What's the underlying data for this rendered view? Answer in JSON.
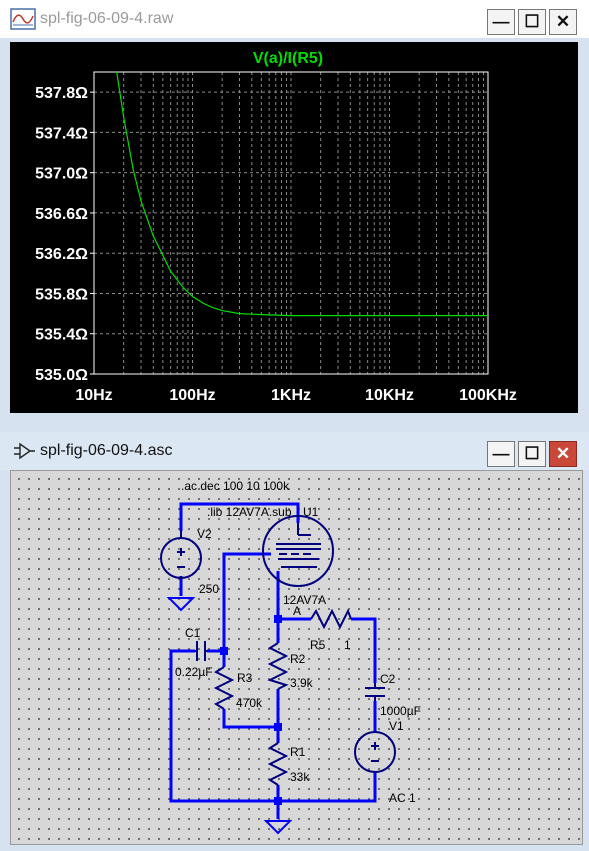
{
  "plot_window": {
    "title": "spl-fig-06-09-4.raw",
    "icon": "waveform-icon",
    "buttons": {
      "minimize": "—",
      "maximize": "☐",
      "close": "✕"
    }
  },
  "schematic_window": {
    "title": "spl-fig-06-09-4.asc",
    "icon": "opamp-symbol-icon",
    "buttons": {
      "minimize": "—",
      "maximize": "☐",
      "close": "✕"
    },
    "directives": {
      "ac": ".ac dec 100 10 100k",
      "lib": ".lib 12AV7A.sub"
    },
    "labels": {
      "u1_name": "U1",
      "u1_value": "12AV7A",
      "node_a": "A",
      "v2_name": "V2",
      "v2_value": "250",
      "r5_name": "R5",
      "r5_value": "1",
      "c1_name": "C1",
      "c1_value": "0.22µF",
      "r3_name": "R3",
      "r3_value": "470k",
      "r2_name": "R2",
      "r2_value": "3.9k",
      "c2_name": "C2",
      "c2_value": "1000µF",
      "v1_name": "V1",
      "v1_value": "AC 1",
      "r1_name": "R1",
      "r1_value": "33k"
    },
    "colors": {
      "wire": "#0000ff",
      "component": "#000080",
      "text": "#000000"
    }
  },
  "chart_data": {
    "type": "line",
    "title": "V(a)/I(R5)",
    "xscale": "log",
    "xlim": [
      10,
      100000
    ],
    "ylim": [
      535.0,
      538.0
    ],
    "x_ticks": [
      "10Hz",
      "100Hz",
      "1KHz",
      "10KHz",
      "100KHz"
    ],
    "y_ticks": [
      "535.0Ω",
      "535.4Ω",
      "535.8Ω",
      "536.2Ω",
      "536.6Ω",
      "537.0Ω",
      "537.4Ω",
      "537.8Ω"
    ],
    "grid": true,
    "series": [
      {
        "name": "V(a)/I(R5)",
        "color": "#00dd00",
        "x": [
          17,
          20,
          25,
          30,
          40,
          50,
          60,
          80,
          100,
          130,
          160,
          200,
          300,
          500,
          1000,
          10000,
          100000
        ],
        "y": [
          538.0,
          537.55,
          537.03,
          536.72,
          536.37,
          536.18,
          536.02,
          535.86,
          535.77,
          535.7,
          535.66,
          535.63,
          535.6,
          535.59,
          535.58,
          535.58,
          535.58
        ]
      }
    ]
  }
}
